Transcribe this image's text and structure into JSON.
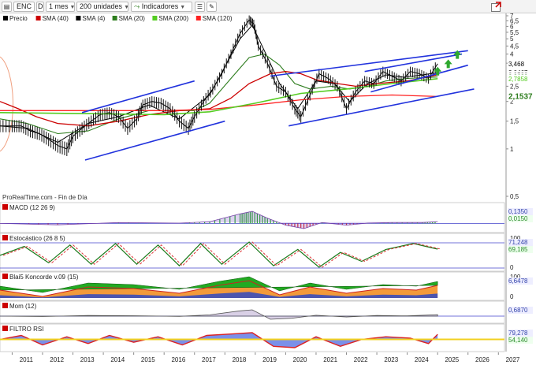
{
  "toolbar": {
    "symbol": "ENC",
    "period_code": "D",
    "interval": "1 mes",
    "units": "200 unidades",
    "indicators": "Indicadores"
  },
  "legend": [
    {
      "label": "Precio",
      "color": "#000000"
    },
    {
      "label": "SMA (40)",
      "color": "#cc0000"
    },
    {
      "label": "SMA (4)",
      "color": "#000000"
    },
    {
      "label": "SMA (20)",
      "color": "#2e7d1e"
    },
    {
      "label": "SMA (200)",
      "color": "#55cc22"
    },
    {
      "label": "SMA (120)",
      "color": "#ff2222"
    }
  ],
  "watermark": "ProRealTime.com - Fin de Día",
  "price_axis": {
    "ticks": [
      "7",
      "6,5",
      "6",
      "5,5",
      "5",
      "4,5",
      "4",
      "3,5",
      "2,5",
      "2",
      "1,5",
      "1",
      "0,5"
    ],
    "ticks_values": [
      7,
      6.5,
      6,
      5.5,
      5,
      4.5,
      4,
      3.5,
      2.5,
      2,
      1.5,
      1,
      0.5
    ],
    "labels": [
      {
        "text": "3,468",
        "value": 3.468,
        "bg": "#ffffff",
        "fg": "#000000"
      },
      {
        "text": "3,0467",
        "value": 3.0467,
        "bg": "#ffffff",
        "fg": "#000000"
      },
      {
        "text": "2,9538",
        "value": 2.9538,
        "bg": "#ffffff",
        "fg": "#000000"
      },
      {
        "text": "2,8639",
        "value": 2.8639,
        "bg": "#ffffff",
        "fg": "#2e7d1e"
      },
      {
        "text": "2,7858",
        "value": 2.7858,
        "bg": "#ffffff",
        "fg": "#55cc22"
      },
      {
        "text": "2,1537",
        "value": 2.1537,
        "bg": "#ffffff",
        "fg": "#2e7d1e"
      }
    ]
  },
  "panels": [
    {
      "title": "MACD (12 26 9)",
      "values": [
        "0,1350",
        "0,0150"
      ],
      "ticks": []
    },
    {
      "title": "Estocástico (26 8 5)",
      "values": [
        "71,248",
        "69,185"
      ],
      "ticks": [
        "100",
        "0"
      ]
    },
    {
      "title": "Blai5 Koncorde v.09 (15)",
      "values": [
        "6,6478"
      ],
      "ticks": [
        "100",
        "0"
      ]
    },
    {
      "title": "Mom (12)",
      "values": [
        "0,6870"
      ],
      "ticks": []
    },
    {
      "title": "FILTRO RSI",
      "values": [
        "79,278",
        "54,140"
      ],
      "ticks": []
    }
  ],
  "x_axis": {
    "labels": [
      "2011",
      "2012",
      "2013",
      "2014",
      "2015",
      "2016",
      "2017",
      "2018",
      "2019",
      "2020",
      "2021",
      "2022",
      "2023",
      "2024",
      "2025",
      "2026",
      "2027"
    ]
  },
  "chart_data": {
    "type": "line",
    "title": "ENC",
    "xlabel": "",
    "ylabel": "",
    "ylim": [
      0.5,
      7
    ],
    "x_range": [
      2010.6,
      2027.2
    ],
    "series": [
      {
        "name": "Precio",
        "points": [
          [
            2010.6,
            1.4
          ],
          [
            2011.0,
            1.4
          ],
          [
            2011.3,
            1.4
          ],
          [
            2011.6,
            1.3
          ],
          [
            2011.9,
            1.25
          ],
          [
            2012.2,
            1.15
          ],
          [
            2012.5,
            1.05
          ],
          [
            2012.8,
            1.0
          ],
          [
            2013.0,
            1.2
          ],
          [
            2013.3,
            1.35
          ],
          [
            2013.6,
            1.5
          ],
          [
            2013.9,
            1.65
          ],
          [
            2014.2,
            1.7
          ],
          [
            2014.5,
            1.6
          ],
          [
            2014.8,
            1.35
          ],
          [
            2015.1,
            1.55
          ],
          [
            2015.3,
            1.9
          ],
          [
            2015.6,
            2.0
          ],
          [
            2015.9,
            1.95
          ],
          [
            2016.2,
            1.8
          ],
          [
            2016.5,
            1.5
          ],
          [
            2016.8,
            1.35
          ],
          [
            2017.0,
            1.6
          ],
          [
            2017.3,
            2.0
          ],
          [
            2017.6,
            2.4
          ],
          [
            2017.9,
            3.0
          ],
          [
            2018.2,
            4.0
          ],
          [
            2018.5,
            5.4
          ],
          [
            2018.8,
            6.6
          ],
          [
            2018.95,
            6.2
          ],
          [
            2019.1,
            4.5
          ],
          [
            2019.4,
            3.5
          ],
          [
            2019.7,
            2.5
          ],
          [
            2020.0,
            2.3
          ],
          [
            2020.3,
            1.8
          ],
          [
            2020.5,
            1.6
          ],
          [
            2020.8,
            2.2
          ],
          [
            2021.1,
            3.0
          ],
          [
            2021.4,
            2.8
          ],
          [
            2021.7,
            2.5
          ],
          [
            2022.0,
            1.8
          ],
          [
            2022.3,
            2.3
          ],
          [
            2022.6,
            2.7
          ],
          [
            2022.9,
            2.6
          ],
          [
            2023.2,
            3.1
          ],
          [
            2023.5,
            2.9
          ],
          [
            2023.8,
            2.7
          ],
          [
            2024.1,
            3.1
          ],
          [
            2024.4,
            3.0
          ],
          [
            2024.7,
            2.8
          ],
          [
            2025.0,
            3.47
          ]
        ]
      },
      {
        "name": "SMA (4)",
        "points": [
          [
            2010.6,
            1.4
          ],
          [
            2011.5,
            1.35
          ],
          [
            2012.5,
            1.1
          ],
          [
            2013.5,
            1.45
          ],
          [
            2014.5,
            1.6
          ],
          [
            2015.5,
            1.9
          ],
          [
            2016.5,
            1.55
          ],
          [
            2017.5,
            2.2
          ],
          [
            2018.5,
            5.0
          ],
          [
            2018.9,
            6.1
          ],
          [
            2019.3,
            4.2
          ],
          [
            2019.8,
            2.6
          ],
          [
            2020.4,
            1.8
          ],
          [
            2021.0,
            2.7
          ],
          [
            2021.6,
            2.6
          ],
          [
            2022.1,
            2.0
          ],
          [
            2022.7,
            2.6
          ],
          [
            2023.3,
            2.95
          ],
          [
            2023.9,
            2.85
          ],
          [
            2024.5,
            2.95
          ],
          [
            2025.0,
            3.05
          ]
        ]
      },
      {
        "name": "SMA (20)",
        "points": [
          [
            2010.6,
            1.55
          ],
          [
            2011.5,
            1.45
          ],
          [
            2012.5,
            1.25
          ],
          [
            2013.5,
            1.3
          ],
          [
            2014.5,
            1.55
          ],
          [
            2015.5,
            1.75
          ],
          [
            2016.5,
            1.75
          ],
          [
            2017.0,
            1.75
          ],
          [
            2017.5,
            1.95
          ],
          [
            2018.2,
            2.8
          ],
          [
            2018.8,
            3.8
          ],
          [
            2019.3,
            4.0
          ],
          [
            2019.8,
            3.4
          ],
          [
            2020.3,
            2.6
          ],
          [
            2020.8,
            2.4
          ],
          [
            2021.5,
            2.5
          ],
          [
            2022.1,
            2.4
          ],
          [
            2022.7,
            2.5
          ],
          [
            2023.3,
            2.7
          ],
          [
            2024.0,
            2.8
          ],
          [
            2025.0,
            2.86
          ]
        ]
      },
      {
        "name": "SMA (40)",
        "points": [
          [
            2010.6,
            2.0
          ],
          [
            2011.2,
            1.8
          ],
          [
            2011.8,
            1.6
          ],
          [
            2012.5,
            1.45
          ],
          [
            2013.5,
            1.4
          ],
          [
            2014.5,
            1.5
          ],
          [
            2015.5,
            1.65
          ],
          [
            2016.5,
            1.75
          ],
          [
            2017.5,
            1.8
          ],
          [
            2018.2,
            2.1
          ],
          [
            2018.8,
            2.6
          ],
          [
            2019.5,
            3.0
          ],
          [
            2020.0,
            3.1
          ],
          [
            2020.5,
            3.0
          ],
          [
            2021.0,
            2.75
          ],
          [
            2021.7,
            2.6
          ],
          [
            2022.3,
            2.5
          ],
          [
            2023.0,
            2.6
          ],
          [
            2024.0,
            2.7
          ],
          [
            2025.0,
            2.95
          ]
        ]
      },
      {
        "name": "SMA (120)",
        "points": [
          [
            2010.6,
            1.75
          ],
          [
            2013.0,
            1.75
          ],
          [
            2016.0,
            1.75
          ],
          [
            2017.5,
            1.78
          ],
          [
            2019.0,
            1.9
          ],
          [
            2020.5,
            2.05
          ],
          [
            2022.0,
            2.15
          ],
          [
            2023.5,
            2.2
          ],
          [
            2025.0,
            2.15
          ]
        ]
      },
      {
        "name": "SMA (200)",
        "points": [
          [
            2010.6,
            1.7
          ],
          [
            2013.0,
            1.68
          ],
          [
            2016.0,
            1.65
          ],
          [
            2017.5,
            1.72
          ],
          [
            2019.0,
            1.95
          ],
          [
            2020.5,
            2.25
          ],
          [
            2022.0,
            2.4
          ],
          [
            2023.5,
            2.6
          ],
          [
            2025.0,
            2.79
          ]
        ]
      }
    ],
    "trend_lines": [
      {
        "from": [
          2013.3,
          1.7
        ],
        "to": [
          2017.0,
          2.7
        ],
        "color": "#2233dd"
      },
      {
        "from": [
          2013.4,
          0.85
        ],
        "to": [
          2018.0,
          1.5
        ],
        "color": "#2233dd"
      },
      {
        "from": [
          2019.5,
          2.9
        ],
        "to": [
          2026.0,
          4.2
        ],
        "color": "#2233dd"
      },
      {
        "from": [
          2020.1,
          1.4
        ],
        "to": [
          2026.2,
          2.4
        ],
        "color": "#2233dd"
      },
      {
        "from": [
          2022.6,
          3.1
        ],
        "to": [
          2025.8,
          4.0
        ],
        "color": "#2233dd"
      },
      {
        "from": [
          2022.8,
          2.3
        ],
        "to": [
          2026.0,
          3.4
        ],
        "color": "#2233dd"
      }
    ],
    "arrows": [
      {
        "x": 2025.0,
        "y": 3.1
      },
      {
        "x": 2025.35,
        "y": 3.45
      },
      {
        "x": 2025.65,
        "y": 3.95
      }
    ],
    "subpanels": {
      "macd": {
        "x": [
          2010.6,
          2012.5,
          2014.5,
          2016.5,
          2017.5,
          2018.5,
          2018.9,
          2019.4,
          2020.0,
          2020.6,
          2021.2,
          2022.0,
          2022.7,
          2023.5,
          2024.5,
          2025.0
        ],
        "values": [
          0.0,
          -0.08,
          0.05,
          0.02,
          0.1,
          0.55,
          0.7,
          0.3,
          -0.1,
          -0.3,
          0.05,
          -0.1,
          0.02,
          0.05,
          0.05,
          0.1
        ]
      },
      "stochastic": {
        "x": [
          2010.6,
          2011.4,
          2012.2,
          2012.9,
          2013.6,
          2014.4,
          2015.1,
          2015.8,
          2016.5,
          2017.2,
          2017.9,
          2018.8,
          2019.6,
          2020.4,
          2021.1,
          2021.8,
          2022.5,
          2023.3,
          2024.2,
          2025.0
        ],
        "values": [
          50,
          80,
          25,
          85,
          20,
          90,
          20,
          85,
          15,
          90,
          20,
          95,
          15,
          70,
          10,
          60,
          30,
          70,
          90,
          71
        ]
      },
      "koncorde": {
        "x": [
          2010.6,
          2012.0,
          2013.5,
          2015.0,
          2016.5,
          2017.8,
          2018.8,
          2019.8,
          2020.8,
          2022.0,
          2023.2,
          2024.3,
          2025.0
        ],
        "values": [
          30,
          10,
          40,
          35,
          20,
          45,
          60,
          15,
          40,
          20,
          35,
          30,
          45
        ]
      },
      "momentum": {
        "x": [
          2010.6,
          2012.0,
          2013.5,
          2015.0,
          2016.5,
          2017.5,
          2018.5,
          2018.9,
          2019.5,
          2020.2,
          2021.0,
          2022.0,
          2023.0,
          2024.0,
          2025.0
        ],
        "values": [
          0.0,
          -0.2,
          0.3,
          0.2,
          -0.1,
          0.6,
          2.5,
          3.0,
          -1.5,
          -1.0,
          0.4,
          -0.4,
          0.3,
          0.1,
          0.69
        ]
      },
      "rsi": {
        "x": [
          2010.6,
          2011.3,
          2012.0,
          2012.8,
          2013.5,
          2014.2,
          2015.0,
          2015.8,
          2016.6,
          2017.4,
          2018.2,
          2018.9,
          2019.6,
          2020.3,
          2021.0,
          2021.8,
          2022.5,
          2023.3,
          2024.1,
          2024.7,
          2025.0
        ],
        "values": [
          60,
          75,
          40,
          70,
          45,
          75,
          50,
          70,
          40,
          75,
          80,
          85,
          35,
          30,
          70,
          35,
          60,
          70,
          65,
          45,
          79
        ]
      }
    }
  }
}
